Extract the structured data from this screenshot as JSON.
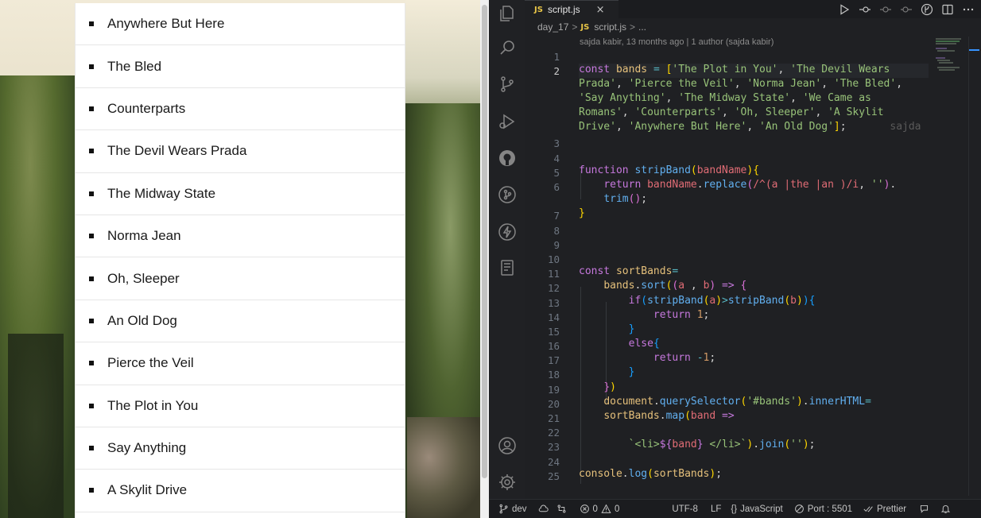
{
  "browser": {
    "bands": [
      "Anywhere But Here",
      "The Bled",
      "Counterparts",
      "The Devil Wears Prada",
      "The Midway State",
      "Norma Jean",
      "Oh, Sleeper",
      "An Old Dog",
      "Pierce the Veil",
      "The Plot in You",
      "Say Anything",
      "A Skylit Drive"
    ]
  },
  "editor": {
    "tab": {
      "badge": "JS",
      "title": "script.js",
      "close": "×"
    },
    "breadcrumb": {
      "folder": "day_17",
      "sep": ">",
      "badge": "JS",
      "file": "script.js",
      "more": "..."
    },
    "blame": "sajda kabir, 13 months ago | 1 author (sajda kabir)",
    "ghost_blame": "sajda",
    "line_numbers": [
      "1",
      "2",
      "",
      "",
      "",
      "",
      "3",
      "4",
      "5",
      "6",
      "",
      "7",
      "8",
      "9",
      "10",
      "11",
      "12",
      "13",
      "14",
      "15",
      "16",
      "17",
      "18",
      "19",
      "20",
      "21",
      "22",
      "23",
      "24",
      "25"
    ],
    "code_lines": {
      "l2a": "const bands = ['The Plot in You', 'The Devil Wears",
      "l2b": "Prada', 'Pierce the Veil', 'Norma Jean', 'The Bled',",
      "l2c": "'Say Anything', 'The Midway State', 'We Came as",
      "l2d": "Romans', 'Counterparts', 'Oh, Sleeper', 'A Skylit",
      "l2e": "Drive', 'Anywhere But Here', 'An Old Dog'];"
    }
  },
  "status_bar": {
    "branch": "dev",
    "errors": "0",
    "warnings": "0",
    "encoding": "UTF-8",
    "eol": "LF",
    "lang_prefix": "{}",
    "language": "JavaScript",
    "port": "Port : 5501",
    "prettier": "Prettier"
  },
  "colors": {
    "keyword": "#c678dd",
    "string": "#98c379",
    "function": "#61afef",
    "variable": "#e5c07b",
    "js_badge": "#e8c547"
  }
}
